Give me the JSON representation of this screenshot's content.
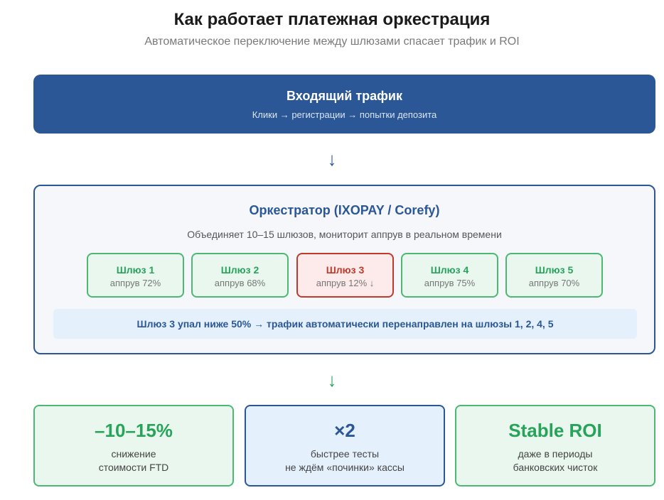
{
  "header": {
    "title": "Как работает платежная оркестрация",
    "subtitle": "Автоматическое переключение между шлюзами спасает трафик и ROI"
  },
  "traffic": {
    "title": "Входящий трафик",
    "subtitle": "Клики → регистрации → попытки депозита"
  },
  "arrows": [
    "↓",
    "↓"
  ],
  "orchestrator": {
    "title": "Оркестратор (IXOPAY / Corefy)",
    "description": "Объединяет 10–15 шлюзов, мониторит аппрув в реальном времени",
    "gateways": [
      {
        "name": "Шлюз 1",
        "rate": "аппрув 72%",
        "status": "ok"
      },
      {
        "name": "Шлюз 2",
        "rate": "аппрув 68%",
        "status": "ok"
      },
      {
        "name": "Шлюз 3",
        "rate": "аппрув 12% ↓",
        "status": "down"
      },
      {
        "name": "Шлюз 4",
        "rate": "аппрув 75%",
        "status": "ok"
      },
      {
        "name": "Шлюз 5",
        "rate": "аппрув 70%",
        "status": "ok"
      }
    ],
    "notice": "Шлюз 3 упал ниже 50% → трафик автоматически перенаправлен на шлюзы 1, 2, 4, 5"
  },
  "results": [
    {
      "value": "–10–15%",
      "line1": "снижение",
      "line2": "стоимости FTD",
      "theme": "green"
    },
    {
      "value": "×2",
      "line1": "быстрее тесты",
      "line2": "не ждём «починки» кассы",
      "theme": "blue"
    },
    {
      "value": "Stable ROI",
      "line1": "даже в периоды",
      "line2": "банковских чисток",
      "theme": "green"
    }
  ],
  "colors": {
    "primary_blue": "#2b5797",
    "success_green": "#27a35a",
    "danger_red": "#c0392b"
  }
}
